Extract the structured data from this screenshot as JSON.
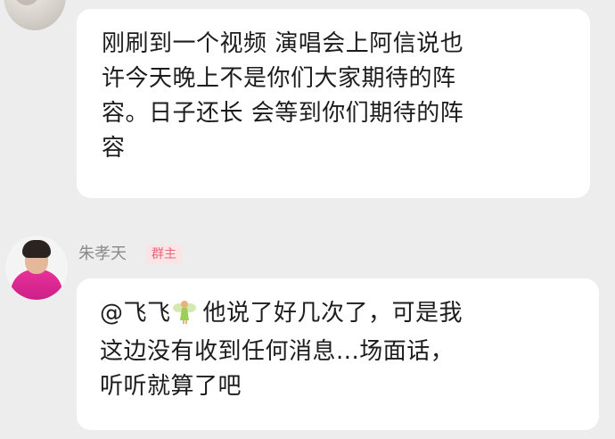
{
  "messages": [
    {
      "lines": [
        "刚刷到一个视频 演唱会上阿信说也",
        "许今天晚上不是你们大家期待的阵",
        "容。日子还长 会等到你们期待的阵",
        "容"
      ]
    },
    {
      "sender": "朱孝天",
      "role_badge": "群主",
      "mention": "@飞飞",
      "mention_icon": "fairy-emoji-icon",
      "lines": [
        "他说了好几次了，可是我",
        "这边没有收到任何消息...场面话，",
        "听听就算了吧"
      ]
    }
  ],
  "colors": {
    "background": "#ededed",
    "bubble": "#ffffff",
    "badge_bg": "#fbe3e6",
    "badge_text": "#e9667a",
    "owner_outfit": "#e8329a"
  }
}
